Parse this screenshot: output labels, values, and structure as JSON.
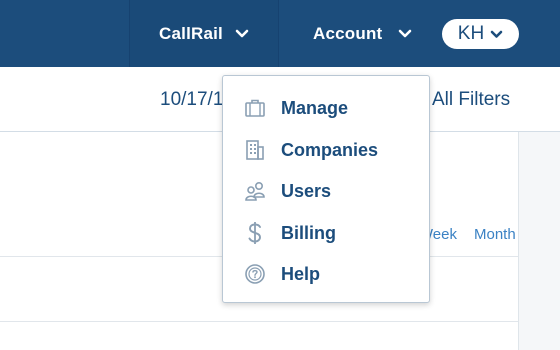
{
  "header": {
    "company_label": "CallRail",
    "account_label": "Account",
    "user_initials": "KH"
  },
  "filters": {
    "date_range": "10/17/1",
    "all_filters_label": "All Filters"
  },
  "timeframe_tabs": {
    "week_label": "Week",
    "month_label": "Month"
  },
  "account_menu": {
    "items": [
      {
        "label": "Manage",
        "icon": "briefcase-icon"
      },
      {
        "label": "Companies",
        "icon": "building-icon"
      },
      {
        "label": "Users",
        "icon": "users-icon"
      },
      {
        "label": "Billing",
        "icon": "dollar-icon"
      },
      {
        "label": "Help",
        "icon": "help-icon"
      }
    ]
  },
  "colors": {
    "header_bg": "#1c4d7c",
    "accent": "#3b82c4",
    "icon_gray": "#8a9fb3"
  }
}
